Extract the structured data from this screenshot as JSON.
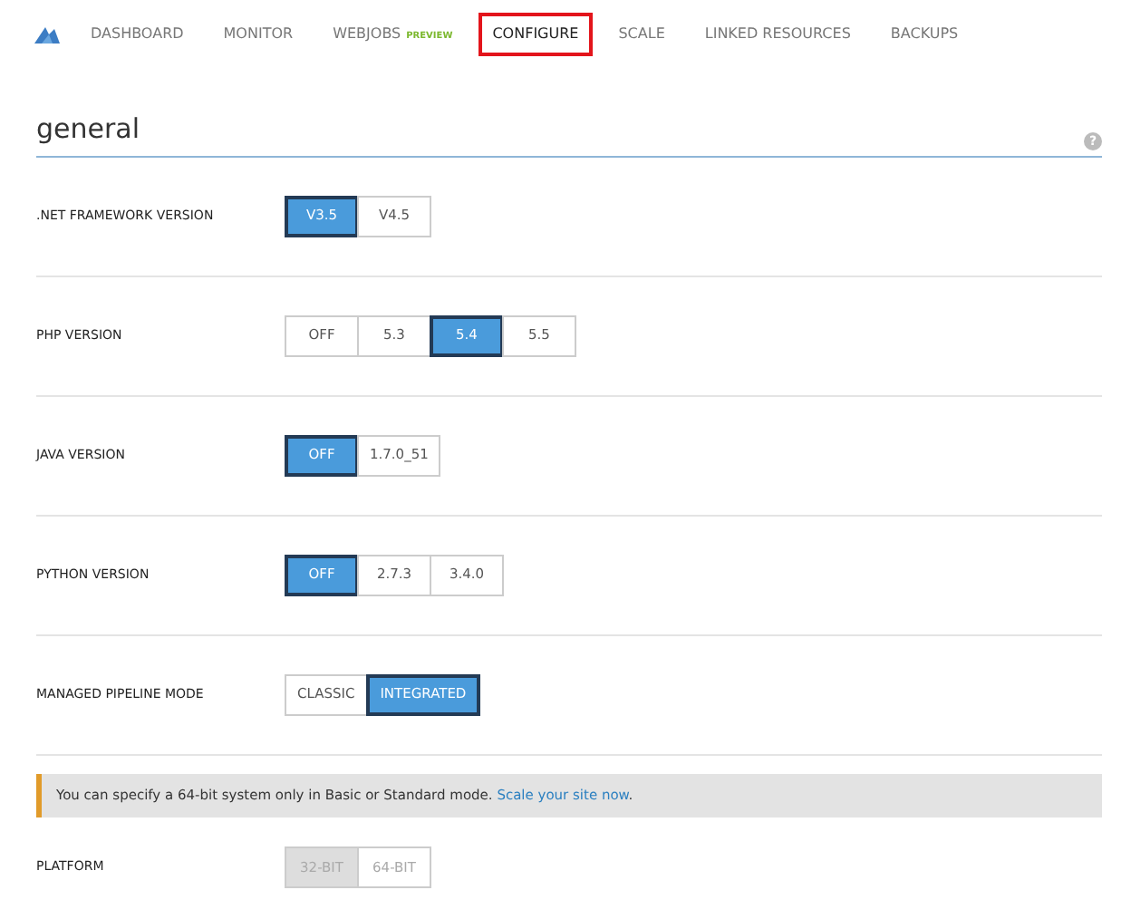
{
  "nav": {
    "items": [
      {
        "label": "DASHBOARD",
        "selected": false
      },
      {
        "label": "MONITOR",
        "selected": false
      },
      {
        "label": "WEBJOBS",
        "badge": "PREVIEW",
        "selected": false
      },
      {
        "label": "CONFIGURE",
        "selected": true
      },
      {
        "label": "SCALE",
        "selected": false
      },
      {
        "label": "LINKED RESOURCES",
        "selected": false
      },
      {
        "label": "BACKUPS",
        "selected": false
      }
    ]
  },
  "section": {
    "title": "general",
    "help": "?"
  },
  "settings": [
    {
      "label": ".NET FRAMEWORK VERSION",
      "options": [
        {
          "label": "V3.5",
          "selected": true
        },
        {
          "label": "V4.5",
          "selected": false
        }
      ]
    },
    {
      "label": "PHP VERSION",
      "options": [
        {
          "label": "OFF",
          "selected": false
        },
        {
          "label": "5.3",
          "selected": false
        },
        {
          "label": "5.4",
          "selected": true
        },
        {
          "label": "5.5",
          "selected": false
        }
      ]
    },
    {
      "label": "JAVA VERSION",
      "options": [
        {
          "label": "OFF",
          "selected": true
        },
        {
          "label": "1.7.0_51",
          "selected": false
        }
      ]
    },
    {
      "label": "PYTHON VERSION",
      "options": [
        {
          "label": "OFF",
          "selected": true
        },
        {
          "label": "2.7.3",
          "selected": false
        },
        {
          "label": "3.4.0",
          "selected": false
        }
      ]
    },
    {
      "label": "MANAGED PIPELINE MODE",
      "options": [
        {
          "label": "CLASSIC",
          "selected": false
        },
        {
          "label": "INTEGRATED",
          "selected": true
        }
      ]
    }
  ],
  "notice": {
    "text": "You can specify a 64-bit system only in Basic or Standard mode. ",
    "link": "Scale your site now",
    "after": "."
  },
  "platform": {
    "label": "PLATFORM",
    "disabled": true,
    "options": [
      {
        "label": "32-BIT",
        "selected": true
      },
      {
        "label": "64-BIT",
        "selected": false
      }
    ]
  }
}
